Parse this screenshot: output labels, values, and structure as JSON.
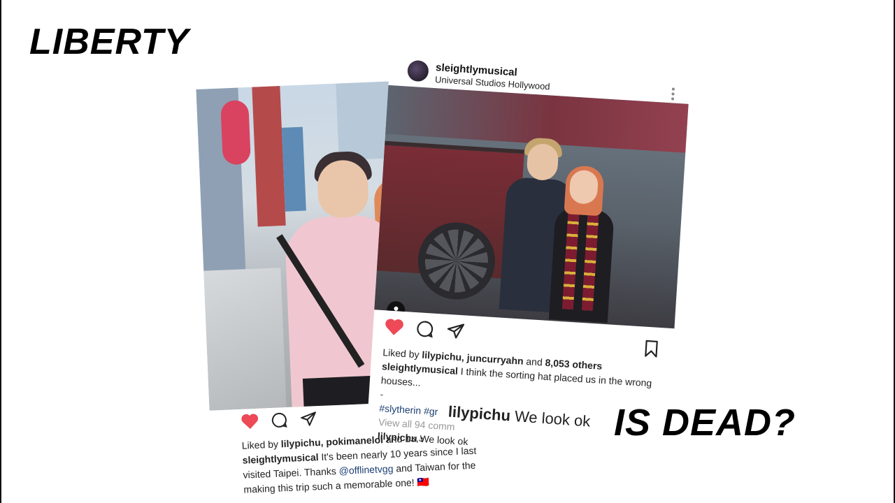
{
  "headline": {
    "top": "LIBERTY",
    "bottom": "IS DEAD?"
  },
  "post_back": {
    "liked_by": "Liked by",
    "liked_users": "lilypichu, pokimanelol",
    "liked_and": "and 13,3",
    "caption_user": "sleightlymusical",
    "caption_part1": "It's been nearly 10 years since I last visited Taipei. Thanks",
    "caption_mention": "@offlinetvgg",
    "caption_part2": "and Taiwan for the making this trip such a memorable one! 🇹🇼"
  },
  "post_front": {
    "username": "sleightlymusical",
    "location": "Universal Studios Hollywood",
    "liked_by": "Liked by",
    "liked_users": "lilypichu, juncurryahn",
    "liked_and": "and",
    "liked_others": "8,053 others",
    "caption_user": "sleightlymusical",
    "caption_text": "I think the sorting hat placed us in the wrong houses...",
    "dash": "-",
    "hashtags": "#slytherin #gr",
    "view_all": "View all 94 comm",
    "comment_user": "lilypichu",
    "comment_text": "We look ok"
  },
  "comment_zoom": {
    "user": "lilypichu",
    "text": "We look ok"
  },
  "colors": {
    "heart": "#ed4956",
    "link": "#1c3f73",
    "scarf_red": "#7d1c30",
    "scarf_gold": "#d8b13a"
  },
  "icons": [
    "heart-icon",
    "comment-icon",
    "share-icon",
    "bookmark-icon",
    "more-icon",
    "user-tag-icon"
  ]
}
